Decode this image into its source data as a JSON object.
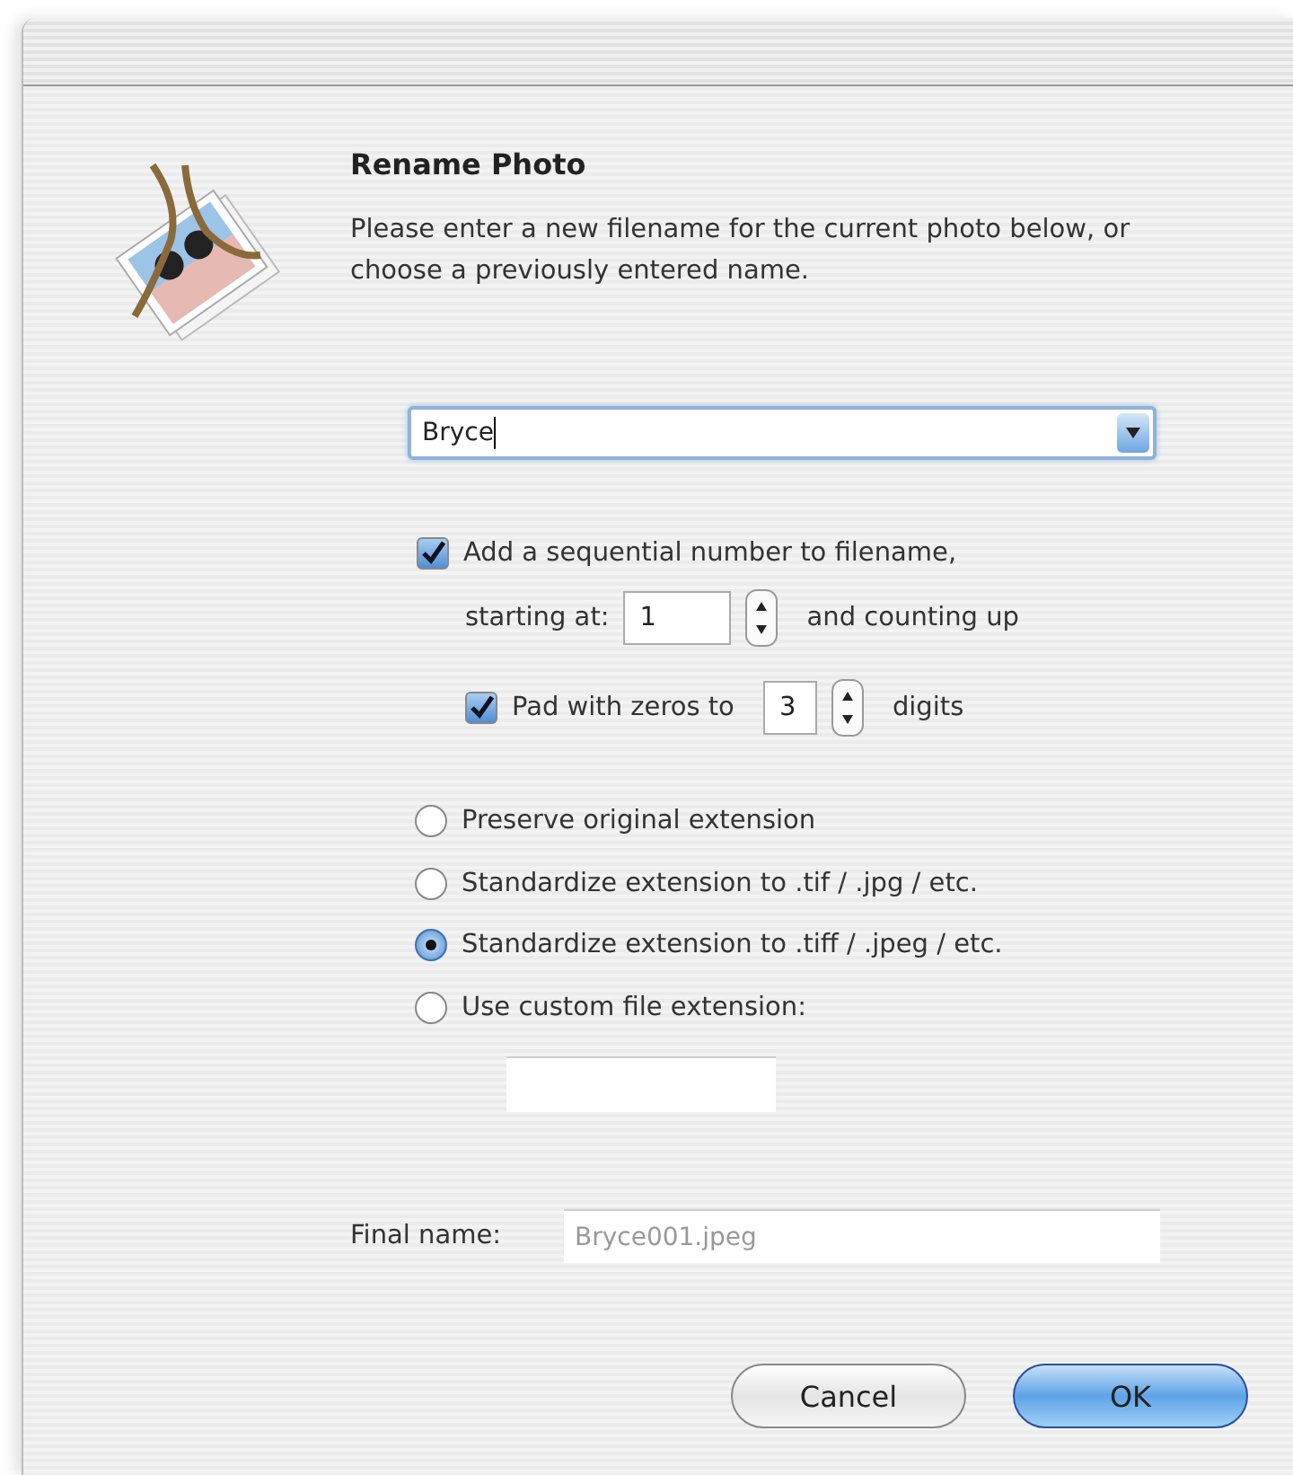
{
  "dialog": {
    "title": "Rename Photo",
    "message": "Please enter a new filename for the current photo below, or choose a previously entered name."
  },
  "filename_combo": {
    "value": "Bryce"
  },
  "sequential": {
    "label": "Add a sequential number to filename,",
    "checked": true,
    "start_label": "starting at:",
    "start_value": "1",
    "suffix": "and counting up"
  },
  "padding": {
    "label": "Pad with zeros to",
    "checked": true,
    "digits_value": "3",
    "suffix": "digits"
  },
  "extension_options": [
    {
      "label": "Preserve original extension",
      "selected": false
    },
    {
      "label": "Standardize extension to .tif / .jpg / etc.",
      "selected": false
    },
    {
      "label": "Standardize extension to .tiff / .jpeg / etc.",
      "selected": true
    },
    {
      "label": "Use custom file extension:",
      "selected": false
    }
  ],
  "final_name": {
    "label": "Final name:",
    "value": "Bryce001.jpeg",
    "disabled": true
  },
  "buttons": [
    {
      "label": "Cancel",
      "default": false
    },
    {
      "label": "OK",
      "default": true
    }
  ]
}
